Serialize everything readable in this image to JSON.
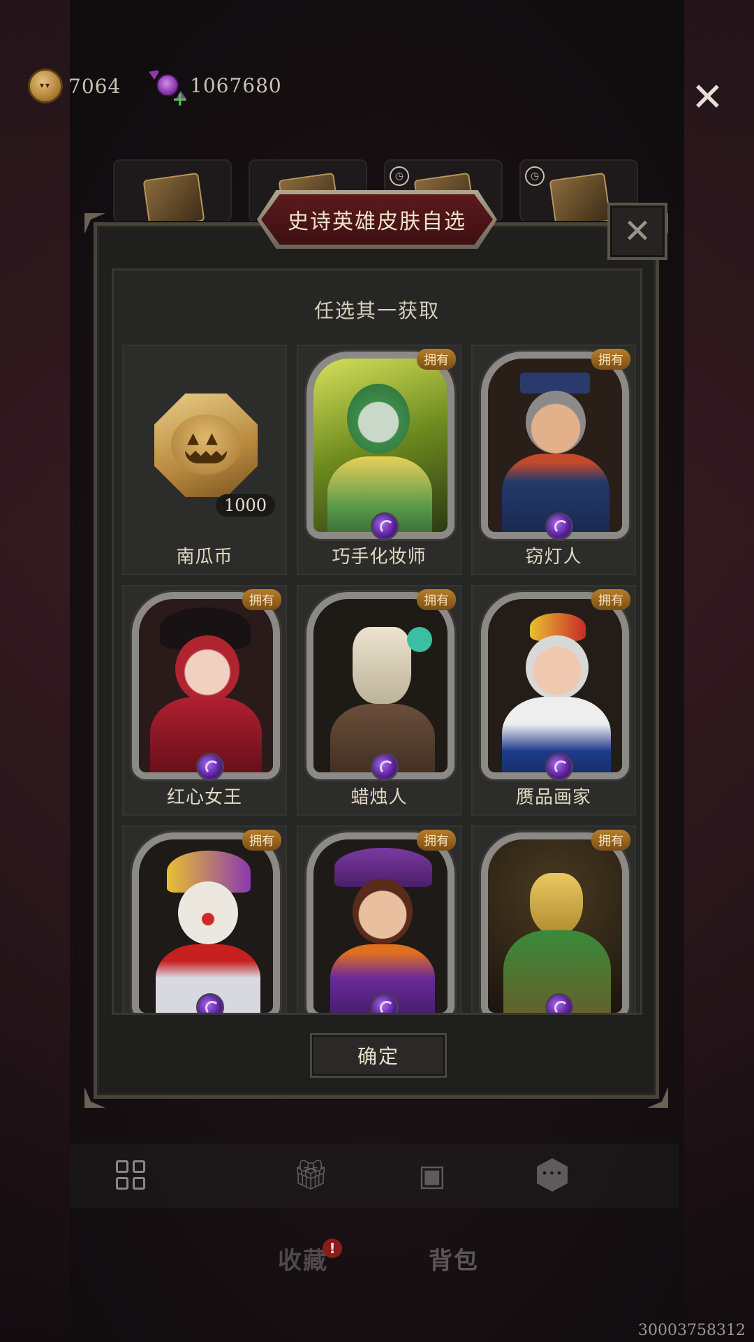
{
  "currencies": [
    {
      "icon": "pumpkin-coin-icon",
      "value": "7064"
    },
    {
      "icon": "candy-icon",
      "value": "1067680"
    }
  ],
  "dialog": {
    "title": "史诗英雄皮肤自选",
    "subtitle": "任选其一获取",
    "owned_label": "拥有",
    "confirm_label": "确定",
    "items": [
      {
        "name": "南瓜币",
        "quantity": "1000",
        "type": "currency"
      },
      {
        "name": "巧手化妆师",
        "owned": true
      },
      {
        "name": "窃灯人",
        "owned": true
      },
      {
        "name": "红心女王",
        "owned": true
      },
      {
        "name": "蜡烛人",
        "owned": true
      },
      {
        "name": "赝品画家",
        "owned": true
      },
      {
        "name": "",
        "owned": true
      },
      {
        "name": "",
        "owned": true
      },
      {
        "name": "",
        "owned": true
      }
    ]
  },
  "bottom_tabs": {
    "collection": "收藏",
    "collection_alert": "!",
    "backpack": "背包"
  },
  "uid": "30003758312",
  "colors": {
    "owned_badge": "#9a6420",
    "dialog_bg": "#1f1f1e",
    "title_banner": "#5b1a1e"
  }
}
